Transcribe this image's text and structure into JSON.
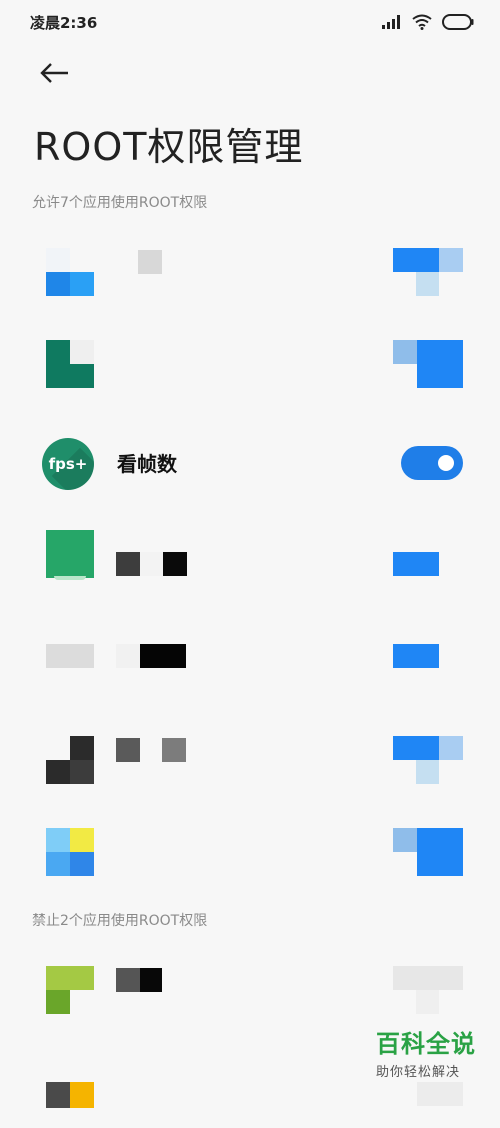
{
  "status_bar": {
    "time": "凌晨2:36"
  },
  "header": {
    "title": "ROOT权限管理"
  },
  "sections": {
    "allowed_label": "允许7个应用使用ROOT权限",
    "denied_label": "禁止2个应用使用ROOT权限"
  },
  "apps": {
    "fps": {
      "name": "看帧数",
      "icon_text": "fps+",
      "enabled": true
    }
  },
  "colors": {
    "accent": "#1f7ee8",
    "fps_icon": "#1f8e6a",
    "watermark": "#2aa245"
  },
  "watermark": {
    "main": "百科全说",
    "sub": "助你轻松解决"
  },
  "icons": [
    "back-arrow-icon",
    "signal-icon",
    "wifi-icon",
    "battery-icon"
  ]
}
